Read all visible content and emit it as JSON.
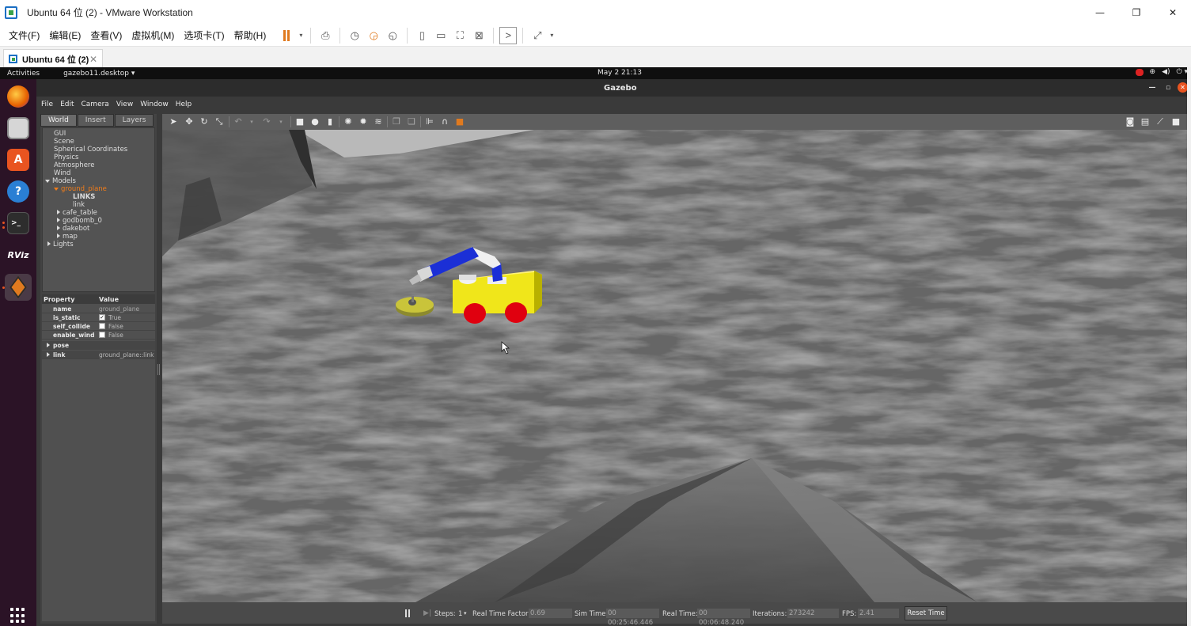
{
  "vmware": {
    "title": "Ubuntu 64 位 (2) - VMware Workstation",
    "menu": [
      "文件(F)",
      "编辑(E)",
      "查看(V)",
      "虚拟机(M)",
      "选项卡(T)",
      "帮助(H)"
    ],
    "tab_label": "Ubuntu 64 位 (2)",
    "window_controls": {
      "minimize": "—",
      "restore": "❐",
      "close": "✕"
    }
  },
  "gnome": {
    "activities": "Activities",
    "app_menu": "gazebo11.desktop ▾",
    "clock": "May 2  21:13",
    "tray": [
      "⊕",
      "◀)",
      "⏻ ▾"
    ]
  },
  "dock": {
    "apps": [
      {
        "name": "firefox",
        "glyph": "🦊",
        "color": "#e66000"
      },
      {
        "name": "files",
        "glyph": "▭",
        "color": "#6d6d6d"
      },
      {
        "name": "software",
        "glyph": "A",
        "color": "#e95420"
      },
      {
        "name": "help",
        "glyph": "?",
        "color": "#2a7fd4"
      },
      {
        "name": "terminal",
        "glyph": ">_",
        "color": "#2b2b2b"
      },
      {
        "name": "rviz",
        "glyph": "RViz",
        "color": "#2b1326"
      },
      {
        "name": "gazebo",
        "glyph": "◆",
        "color": "#e07a1f"
      }
    ]
  },
  "gazebo": {
    "title": "Gazebo",
    "menu": [
      "File",
      "Edit",
      "Camera",
      "View",
      "Window",
      "Help"
    ],
    "left_tabs": [
      "World",
      "Insert",
      "Layers"
    ],
    "tree": {
      "gui": "GUI",
      "scene": "Scene",
      "spherical": "Spherical Coordinates",
      "physics": "Physics",
      "atmosphere": "Atmosphere",
      "wind": "Wind",
      "models": "Models",
      "ground_plane": "ground_plane",
      "links": "LINKS",
      "link": "link",
      "cafe_table": "cafe_table",
      "godbomb": "godbomb_0",
      "dakebot": "dakebot",
      "map": "map",
      "lights": "Lights"
    },
    "props": {
      "h_property": "Property",
      "h_value": "Value",
      "name_k": "name",
      "name_v": "ground_plane",
      "static_k": "is_static",
      "static_v": "True",
      "static_checked": true,
      "collide_k": "self_collide",
      "collide_v": "False",
      "collide_checked": false,
      "wind_k": "enable_wind",
      "wind_v": "False",
      "wind_checked": false,
      "pose": "pose",
      "link_k": "link",
      "link_v": "ground_plane::link"
    },
    "status": {
      "steps_label": "Steps:",
      "steps_value": "1",
      "rtf_label": "Real Time Factor:",
      "rtf_value": "0.69",
      "sim_label": "Sim Time:",
      "sim_value": "00 00:25:46.446",
      "real_label": "Real Time:",
      "real_value": "00 00:06:48.240",
      "iter_label": "Iterations:",
      "iter_value": "273242",
      "fps_label": "FPS:",
      "fps_value": "2.41",
      "reset": "Reset Time"
    }
  }
}
